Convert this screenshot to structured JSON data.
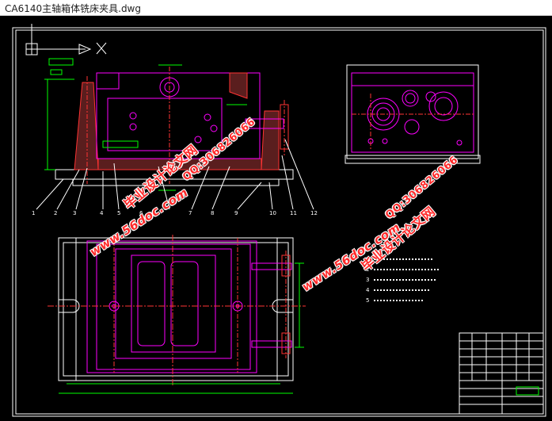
{
  "window": {
    "title": "CA6140主轴箱体铣床夹具.dwg"
  },
  "colors": {
    "background": "#000000",
    "frame": "#ffffff",
    "part": "#ff00ff",
    "dimension": "#00ff00",
    "centerline": "#ff3333",
    "watermark": "#ff2a2a"
  },
  "drawing": {
    "part_labels": [
      "1",
      "2",
      "3",
      "4",
      "5",
      "6",
      "7",
      "8",
      "9",
      "10",
      "11",
      "12"
    ],
    "technical_requirements": [
      "1",
      "2",
      "3",
      "4",
      "5"
    ]
  },
  "watermarks": {
    "site": "www.56doc.com",
    "qq": "QQ:306826066",
    "name": "毕业设计论文网"
  }
}
